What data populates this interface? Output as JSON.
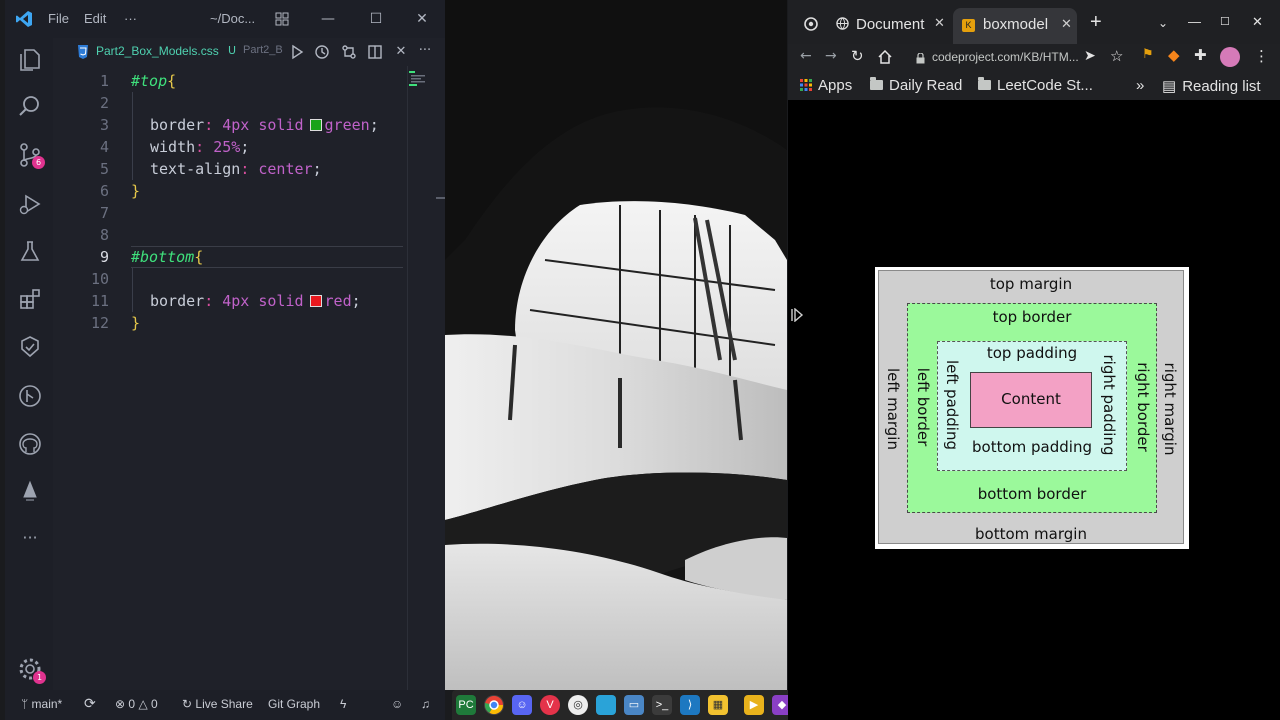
{
  "vscode": {
    "menu": [
      "File",
      "Edit",
      "···"
    ],
    "title": "~/Doc...",
    "tab": {
      "filename": "Part2_Box_Models.css",
      "modified": "U",
      "next_tab": "Part2_B"
    },
    "activity_badges": {
      "source_control": "6",
      "settings": "1"
    },
    "code_lines": [
      {
        "n": "1"
      },
      {
        "n": "2"
      },
      {
        "n": "3"
      },
      {
        "n": "4"
      },
      {
        "n": "5"
      },
      {
        "n": "6"
      },
      {
        "n": "7"
      },
      {
        "n": "8"
      },
      {
        "n": "9"
      },
      {
        "n": "10"
      },
      {
        "n": "11"
      },
      {
        "n": "12"
      }
    ],
    "code": {
      "sel_top": "#top",
      "sel_bottom": "#bottom",
      "open": "{",
      "close": "}",
      "border": "border",
      "width": "width",
      "text_align": "text-align",
      "colon": ":",
      "semi": ";",
      "four_px": "4px",
      "solid": "solid",
      "green": "green",
      "red": "red",
      "twentyfive": "25%",
      "center": "center"
    },
    "colors": {
      "green_swatch": "#1aa31a",
      "red_swatch": "#e8181e"
    },
    "status": {
      "branch": "main*",
      "errors": "0",
      "warnings": "0",
      "live_share": "Live Share",
      "git_graph": "Git Graph"
    }
  },
  "chrome": {
    "tabs": [
      {
        "title": "Document"
      },
      {
        "title": "boxmodel"
      }
    ],
    "new_tab": "+",
    "url": "codeproject.com/KB/HTM...",
    "bookmarks": [
      {
        "label": "Apps"
      },
      {
        "label": "Daily Read"
      },
      {
        "label": "LeetCode St..."
      }
    ],
    "more_bookmarks": "»",
    "reading_list": "Reading list"
  },
  "box_model": {
    "top_margin": "top margin",
    "bottom_margin": "bottom margin",
    "left_margin": "left margin",
    "right_margin": "right margin",
    "top_border": "top border",
    "bottom_border": "bottom border",
    "left_border": "left border",
    "right_border": "right border",
    "top_padding": "top padding",
    "bottom_padding": "bottom padding",
    "left_padding": "left padding",
    "right_padding": "right padding",
    "content": "Content"
  }
}
